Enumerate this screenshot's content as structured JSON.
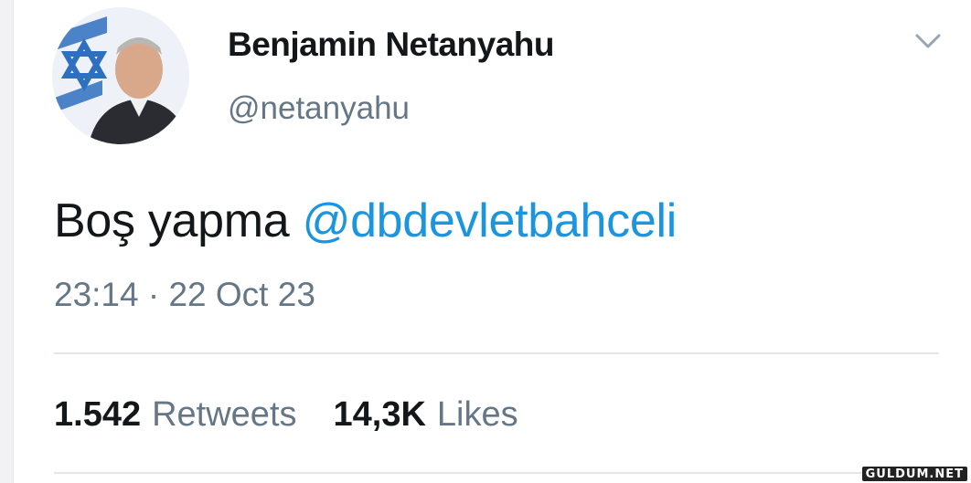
{
  "tweet": {
    "author": {
      "display_name": "Benjamin Netanyahu",
      "handle": "@netanyahu",
      "avatar": "avatar-portrait"
    },
    "menu_icon": "chevron-down-icon",
    "text_plain": "Boş yapma ",
    "mention": "@dbdevletbahceli",
    "timestamp": "23:14 · 22 Oct 23",
    "stats": {
      "retweets_count": "1.542",
      "retweets_label": "Retweets",
      "likes_count": "14,3K",
      "likes_label": "Likes"
    }
  },
  "watermark": "GULDUM.NET",
  "colors": {
    "mention": "#1b95e0",
    "secondary_text": "#657786",
    "primary_text": "#14171a",
    "divider": "#e1e8ed"
  }
}
